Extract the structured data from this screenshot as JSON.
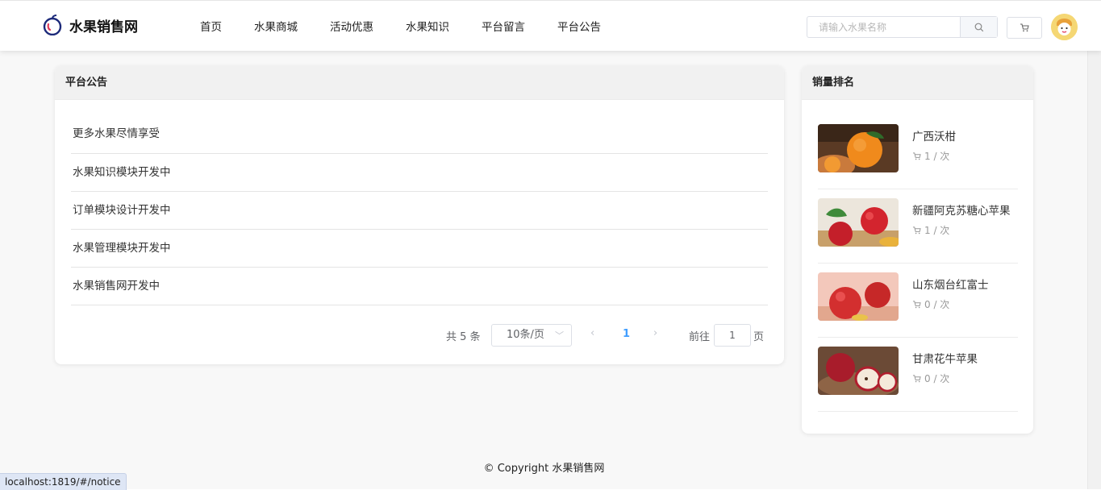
{
  "header": {
    "logo_text": "水果销售网",
    "nav": [
      "首页",
      "水果商城",
      "活动优惠",
      "水果知识",
      "平台留言",
      "平台公告"
    ],
    "search_placeholder": "请输入水果名称"
  },
  "notice_panel": {
    "title": "平台公告",
    "items": [
      "更多水果尽情享受",
      "水果知识模块开发中",
      "订单模块设计开发中",
      "水果管理模块开发中",
      "水果销售网开发中"
    ],
    "pagination": {
      "total": "共 5 条",
      "page_size": "10条/页",
      "current_page": "1",
      "goto_label": "前往",
      "goto_value": "1",
      "goto_unit": "页"
    }
  },
  "ranking_panel": {
    "title": "销量排名",
    "items": [
      {
        "name": "广西沃柑",
        "sales": "1 / 次",
        "image": "mandarin"
      },
      {
        "name": "新疆阿克苏糖心苹果",
        "sales": "1 / 次",
        "image": "apple-leaves"
      },
      {
        "name": "山东烟台红富士",
        "sales": "0 / 次",
        "image": "red-apples"
      },
      {
        "name": "甘肃花牛苹果",
        "sales": "0 / 次",
        "image": "apple-halves"
      }
    ]
  },
  "footer": {
    "copyright": "© Copyright 水果销售网"
  },
  "status_bar": {
    "url": "localhost:1819/#/notice"
  },
  "colors": {
    "accent": "#409eff",
    "logo": "#1d2a7a",
    "header_bg": "#f1f1f1"
  }
}
